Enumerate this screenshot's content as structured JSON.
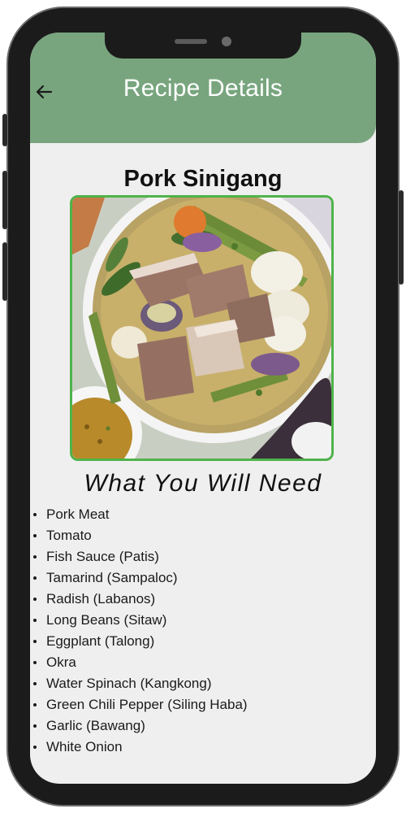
{
  "header": {
    "title": "Recipe Details",
    "background": "#78a57e"
  },
  "icons": {
    "back": "arrow-left-icon"
  },
  "recipe": {
    "name": "Pork Sinigang",
    "image_border_color": "#4fb34a",
    "section_title": "What You Will Need",
    "ingredients": [
      "Pork Meat",
      "Tomato",
      "Fish Sauce (Patis)",
      "Tamarind (Sampaloc)",
      "Radish (Labanos)",
      "Long Beans (Sitaw)",
      "Eggplant (Talong)",
      "Okra",
      "Water Spinach (Kangkong)",
      "Green Chili Pepper (Siling Haba)",
      "Garlic (Bawang)",
      "White Onion"
    ]
  }
}
